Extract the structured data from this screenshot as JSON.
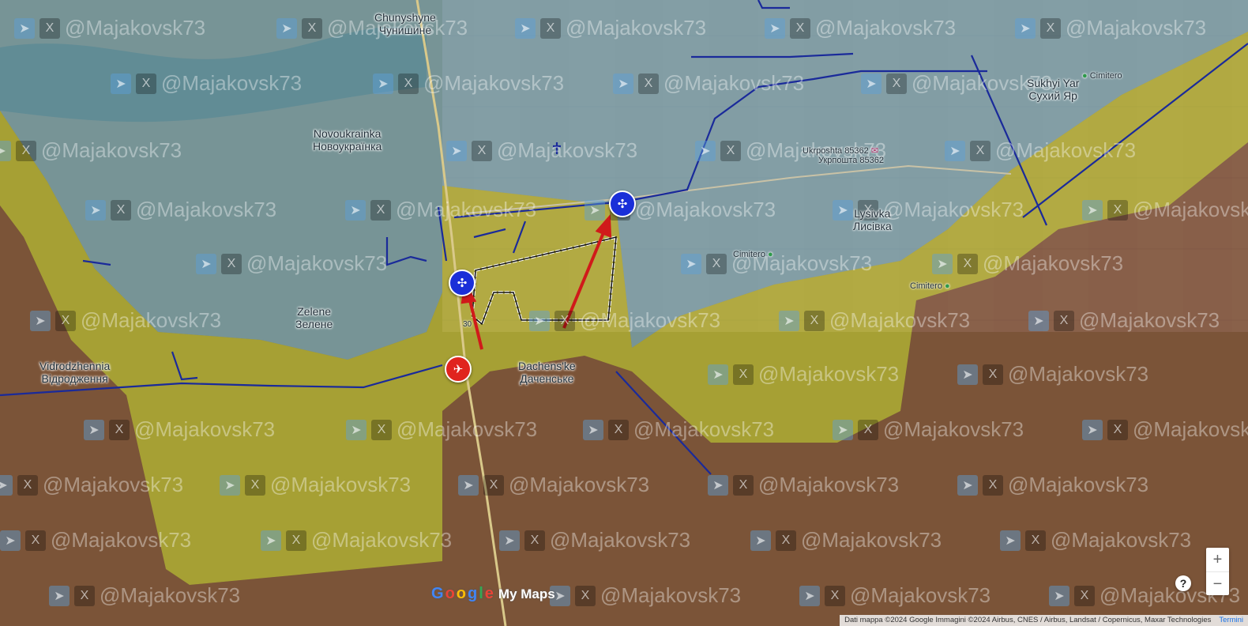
{
  "map": {
    "places": [
      {
        "latin": "Chunyshyne",
        "native": "Чунишине"
      },
      {
        "latin": "Novoukrainka",
        "native": "Новоукраїнка"
      },
      {
        "latin": "Sukhyi Yar",
        "native": "Сухий Яр"
      },
      {
        "latin": "Lysivka",
        "native": "Лисівка"
      },
      {
        "latin": "Zelene",
        "native": "Зелене"
      },
      {
        "latin": "Vidrodzhennia",
        "native": "Відродження"
      },
      {
        "latin": "Dachens'ke",
        "native": "Дачeнське"
      }
    ],
    "pois": [
      {
        "line1": "Ukrposhta 85362",
        "line2": "Укрпошта 85362",
        "icon": "mail-icon"
      },
      {
        "line1": "Cimitero",
        "icon": "cemetery-icon"
      },
      {
        "line1": "Cimitero",
        "icon": "cemetery-icon"
      },
      {
        "line1": "Cimitero",
        "icon": "cemetery-icon"
      }
    ],
    "watermark": "@Majakovsk73",
    "road_number": "30",
    "zones": {
      "ukrainian_controlled_color": "#6fa6c6",
      "contested_color": "#c8c820",
      "russian_controlled_color": "#8b3a24",
      "front_line_color": "#1a2a9a",
      "advance_arrow_color": "#d01a1a"
    },
    "markers": [
      {
        "type": "drone",
        "color": "#1a2fd8",
        "icon": "drone-icon"
      },
      {
        "type": "drone",
        "color": "#1a2fd8",
        "icon": "drone-icon"
      },
      {
        "type": "aircraft",
        "color": "#e0241e",
        "icon": "plane-icon"
      }
    ]
  },
  "controls": {
    "zoom_in": "+",
    "zoom_out": "−",
    "help": "?"
  },
  "branding": {
    "logo_letters": [
      "G",
      "o",
      "o",
      "g",
      "l",
      "e"
    ],
    "product": "My Maps"
  },
  "attribution": {
    "text": "Dati mappa ©2024 Google Immagini ©2024 Airbus, CNES / Airbus, Landsat / Copernicus, Maxar Technologies",
    "terms": "Termini"
  }
}
